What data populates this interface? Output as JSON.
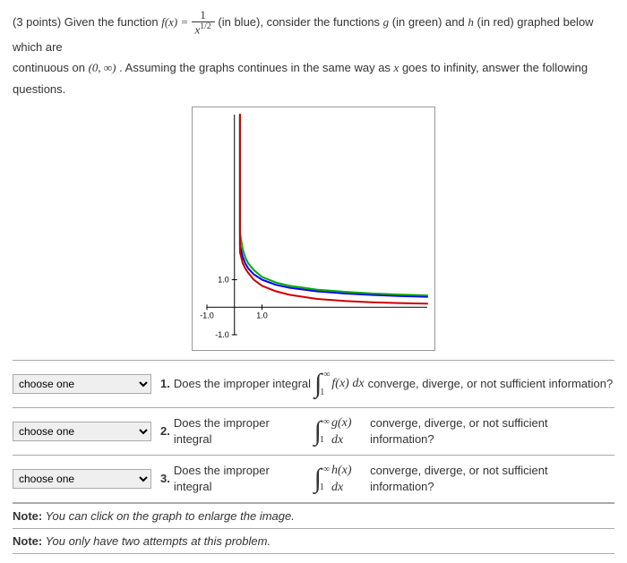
{
  "problem": {
    "points_prefix": "(3 points) Given the function ",
    "fx_lhs": "f(x) = ",
    "frac_num": "1",
    "frac_den_base": "x",
    "frac_den_exp": "1/2",
    "after_frac": " (in blue), consider the functions ",
    "g": "g",
    "g_note": " (in green) and ",
    "h": "h",
    "h_note": " (in red) graphed below which are",
    "line2a": "continuous on ",
    "interval": "(0, ∞)",
    "line2b": ". Assuming the graphs continues in the same way as ",
    "xvar": "x",
    "line2c": " goes to infinity, answer the following questions."
  },
  "dropdown_placeholder": "choose one",
  "questions": [
    {
      "num": "1.",
      "pre": " Does the improper integral ",
      "integrand": "f(x) dx",
      "post": " converge, diverge, or not sufficient information?"
    },
    {
      "num": "2.",
      "pre": " Does the improper integral ",
      "integrand": "g(x) dx",
      "post": " converge, diverge, or not sufficient information?"
    },
    {
      "num": "3.",
      "pre": " Does the improper integral ",
      "integrand": "h(x) dx",
      "post": " converge, diverge, or not sufficient information?"
    }
  ],
  "bounds": {
    "lower": "1",
    "upper": "∞"
  },
  "notes": [
    {
      "label": "Note:",
      "text": " You can click on the graph to enlarge the image."
    },
    {
      "label": "Note:",
      "text": " You only have two attempts at this problem."
    }
  ],
  "chart_data": {
    "type": "line",
    "x_range": [
      -1,
      7
    ],
    "y_range": [
      -1,
      7
    ],
    "x_ticks": [
      -1,
      1
    ],
    "y_ticks": [
      -1,
      1
    ],
    "x": [
      0.2,
      0.3,
      0.4,
      0.5,
      0.7,
      1.0,
      1.5,
      2.0,
      3.0,
      4.0,
      5.0,
      6.0,
      7.0
    ],
    "series": [
      {
        "name": "f(x)=1/x^{1/2}",
        "color": "#0000ff",
        "values": [
          2.236,
          1.826,
          1.581,
          1.414,
          1.195,
          1.0,
          0.816,
          0.707,
          0.577,
          0.5,
          0.447,
          0.408,
          0.378
        ]
      },
      {
        "name": "g(x)",
        "color": "#00aa00",
        "values": [
          2.7,
          2.1,
          1.8,
          1.6,
          1.35,
          1.1,
          0.9,
          0.78,
          0.64,
          0.56,
          0.5,
          0.46,
          0.43
        ]
      },
      {
        "name": "h(x)",
        "color": "#cc0000",
        "values": [
          2.0,
          1.6,
          1.4,
          1.25,
          1.0,
          0.78,
          0.58,
          0.45,
          0.3,
          0.23,
          0.18,
          0.15,
          0.13
        ]
      }
    ]
  }
}
